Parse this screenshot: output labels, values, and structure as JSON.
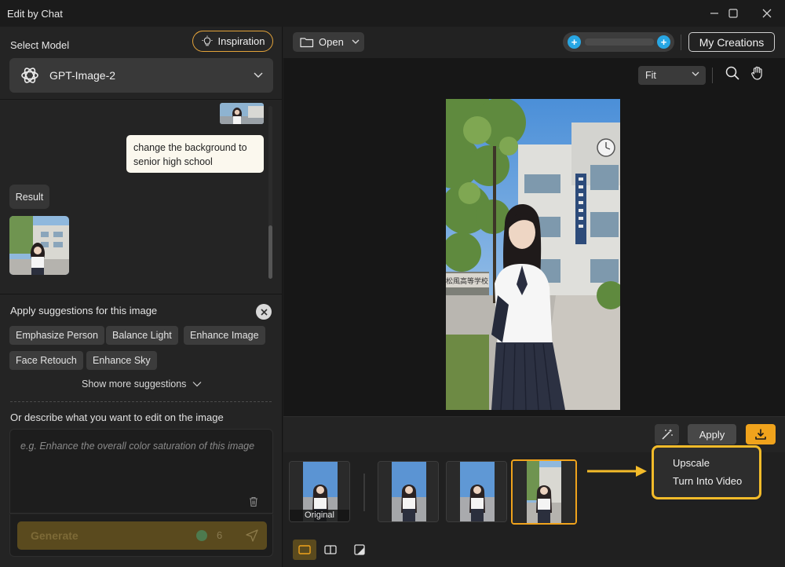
{
  "window": {
    "title": "Edit by Chat"
  },
  "left_panel": {
    "select_model_label": "Select Model",
    "inspiration_label": "Inspiration",
    "model_name": "GPT-Image-2",
    "chat": {
      "user_message": "change the background to senior high school",
      "result_label": "Result"
    },
    "suggestions": {
      "title": "Apply suggestions for this image",
      "chips": [
        "Emphasize Person",
        "Balance Light",
        "Enhance Image",
        "Face Retouch",
        "Enhance Sky"
      ],
      "show_more": "Show more suggestions"
    },
    "describe_label": "Or describe what you want to edit on the image",
    "input_placeholder": "e.g. Enhance the overall color saturation of this image",
    "generate_label": "Generate",
    "credit_cost": "6"
  },
  "toolbar": {
    "open_label": "Open",
    "my_creations_label": "My Creations"
  },
  "canvas": {
    "zoom_select": "Fit",
    "school_sign": "松風高等学校"
  },
  "actions": {
    "apply_label": "Apply"
  },
  "filmstrip": {
    "original_caption": "Original",
    "thumb_count": 4,
    "selected_index": 3
  },
  "download_menu": {
    "items": [
      "Upscale",
      "Turn Into Video"
    ]
  },
  "colors": {
    "accent": "#f0a31c",
    "highlight": "#f3bb2a",
    "credit_blue": "#28a7e4"
  }
}
